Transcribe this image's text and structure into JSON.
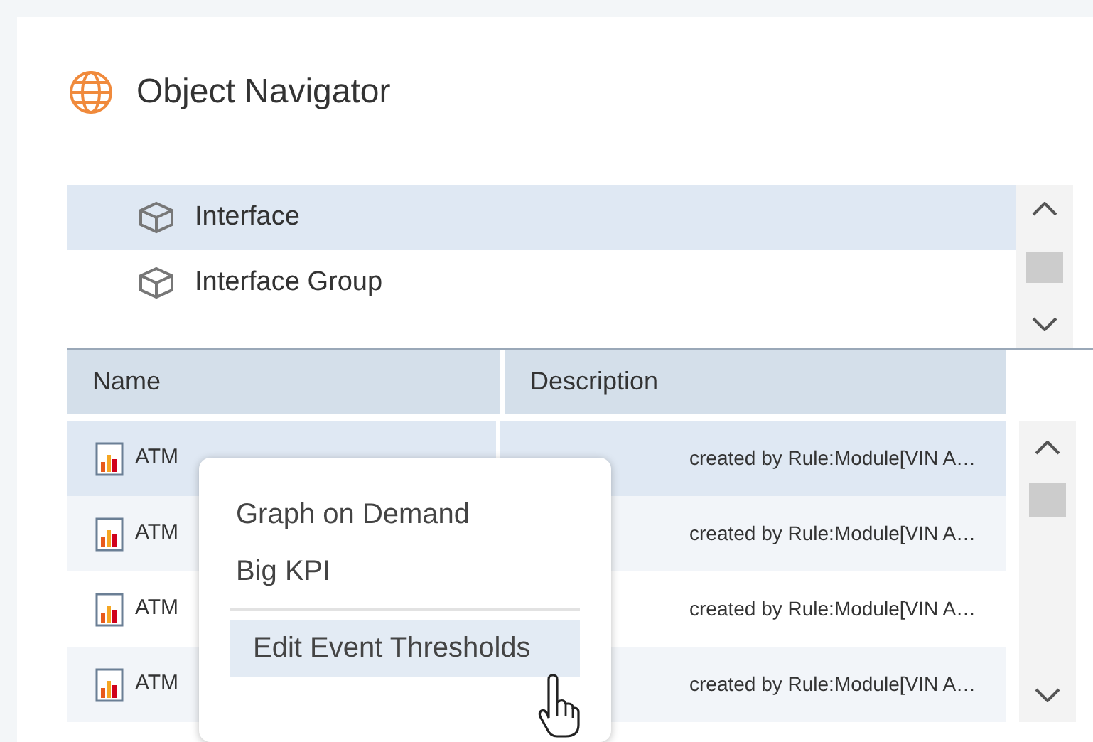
{
  "panel": {
    "title": "Object Navigator"
  },
  "tree": {
    "items": [
      {
        "label": "Interface",
        "selected": true
      },
      {
        "label": "Interface Group",
        "selected": false
      }
    ]
  },
  "table": {
    "columns": [
      "Name",
      "Description"
    ],
    "rows": [
      {
        "name": "ATM",
        "description": "created by Rule:Module[VIN A…",
        "selected": true
      },
      {
        "name": "ATM",
        "description": "created by Rule:Module[VIN A…",
        "selected": false
      },
      {
        "name": "ATM",
        "description": "created by Rule:Module[VIN A…",
        "selected": false
      },
      {
        "name": "ATM",
        "description": "created by Rule:Module[VIN A…",
        "selected": false
      }
    ]
  },
  "context_menu": {
    "items": [
      {
        "label": "Graph on Demand",
        "selected": false,
        "separator_before": false
      },
      {
        "label": "Big KPI",
        "selected": false,
        "separator_before": false
      },
      {
        "label": "Edit Event Thresholds",
        "selected": true,
        "separator_before": true
      }
    ]
  }
}
